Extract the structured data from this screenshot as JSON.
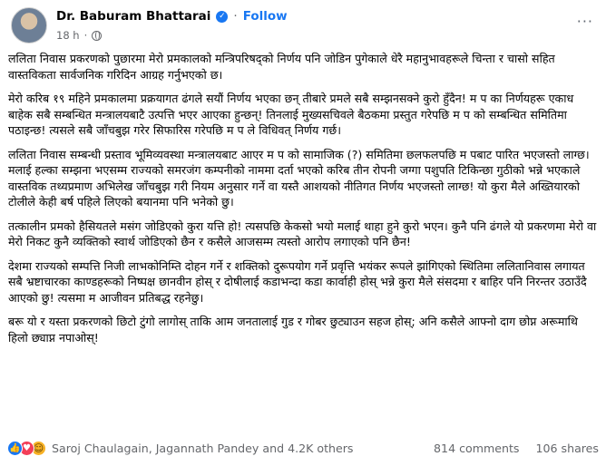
{
  "post": {
    "author": "Dr. Baburam Bhattarai",
    "follow_label": "Follow",
    "time": "18 h",
    "more_label": "···",
    "paragraphs": [
      "ललिता निवास प्रकरणको पुछारमा मेरो प्रमकालको मन्त्रिपरिषद्को निर्णय पनि जोडिन पुगेकाले धेरै महानुभावहरूले चिन्ता र चासो सहित वास्तविकता सार्वजनिक गरिदिन आग्रह गर्नुभएको छ।",
      "मेरो करिब १९ महिने प्रमकालमा प्रक्रयागत ढंगले सयौं निर्णय भएका छन् तीबारे प्रमले सबै सम्झनसक्ने कुरो हुँदैन! म प का निर्णयहरू एकाध बाहेक सबै सम्बन्धित मन्त्रालयबाटै उत्पत्ति भएर आएका हुन्छन्! तिनलाई मुख्यसचिवले बैठकमा प्रस्तुत गरेपछि म प को सम्बन्धित समितिमा पठाइन्छ! त्यसले सबै जाँचबुझ गरेर सिफारिस गरेपछि म प ले विधिवत् निर्णय गर्छ।",
      "ललिता निवास सम्बन्धी प्रस्ताव भूमिव्यवस्था मन्त्रालयबाट आएर म प को सामाजिक (?) समितिमा छलफलपछि म पबाट पारित भएजस्तो लाग्छ।मलाई हल्का सम्झना भएसम्म राज्यको समरजंग कम्पनीको नाममा दर्ता भएको करिब तीन रोपनी जग्गा पशुपति टिकिन्छा गुठीको भन्ने भएकाले वास्तविक तथ्यप्रमाण अभिलेख जाँचबुझ गरी नियम अनुसार गर्ने वा यस्तै आशयको नीतिगत निर्णय भएजस्तो लाग्छ! यो कुरा मैले अख्तियारको टोलीले केही बर्ष पहिले लिएको बयानमा पनि भनेको छु।",
      "तत्कालीन प्रमको हैसियतले मसंग जोडिएको कुरा यत्ति हो! त्यसपछि केकसो भयो मलाई थाहा हुने कुरो भएन। कुनै पनि ढंगले यो प्रकरणमा मेरो वा मेरो निकट कुनै व्यक्तिको स्वार्थ जोडिएको छैन र कसैले आजसम्म त्यस्तो आरोप लगाएको पनि छैन!",
      "देशमा राज्यको सम्पत्ति निजी लाभकोनिम्ति दोहन गर्ने र शक्तिको दुरूपयोग गर्ने प्रवृत्ति भयंकर रूपले झांगिएको स्थितिमा ललितानिवास लगायत सबै भ्रष्टाचारका काण्डहरूको निष्पक्ष छानवीन होस् र दोषीलाई कडाभन्दा कडा कार्वाही होस् भन्ने कुरा मैले संसदमा र बाहिर पनि निरन्तर उठाउँदै आएको छु! त्यसमा म आजीवन प्रतिबद्ध रहनेछु।",
      "बरू यो र यस्ता प्रकरणको छिटो टुंगो लागोस् ताकि आम जनतालाई गुड र गोबर छुट्याउन सहज होस्; अनि कसैले आफ्नो दाग छोप्न अरूमाथि हिलो छ्याप्न नपाओस्!"
    ]
  },
  "footer": {
    "reactions": [
      "like",
      "love",
      "haha"
    ],
    "reactors": "Saroj Chaulagain, Jagannath Pandey and 4.2K others",
    "comments": "814 comments",
    "shares": "106 shares"
  }
}
